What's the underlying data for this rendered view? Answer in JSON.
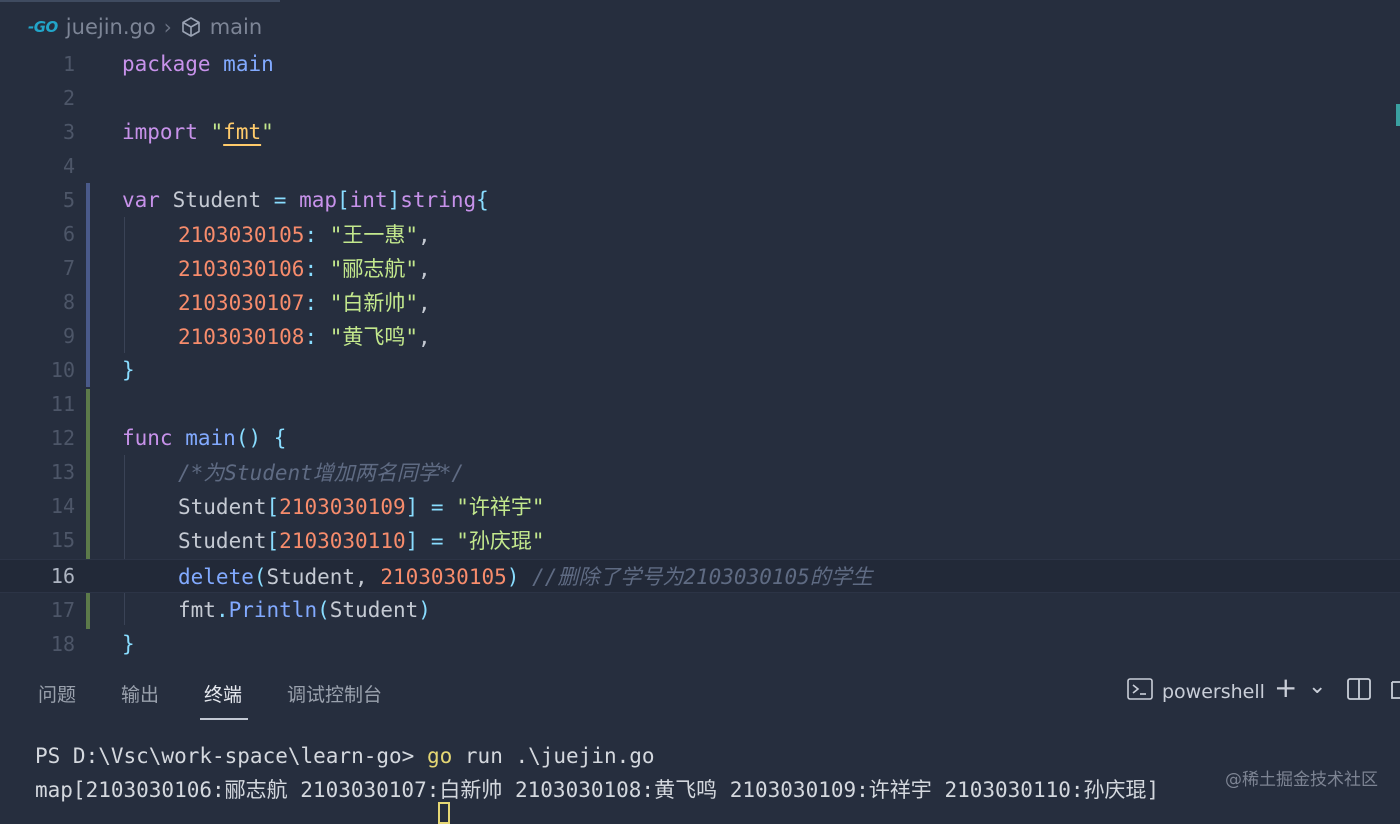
{
  "breadcrumb": {
    "go_badge": "-GO",
    "file": "juejin.go",
    "separator": "›",
    "symbol": "main"
  },
  "editor": {
    "line_numbers": [
      "1",
      "2",
      "3",
      "4",
      "5",
      "6",
      "7",
      "8",
      "9",
      "10",
      "11",
      "12",
      "13",
      "14",
      "15",
      "16",
      "17",
      "18"
    ],
    "active_line": 16,
    "lines": {
      "l1": {
        "kw": "package",
        "name": "main"
      },
      "l3": {
        "kw": "import",
        "q1": "\"",
        "pkg": "fmt",
        "q2": "\""
      },
      "l5": {
        "kw": "var",
        "rest1": "Student ",
        "eq": "=",
        "map": "map",
        "br1": "[",
        "int": "int",
        "br2": "]",
        "str": "string",
        "brace": "{"
      },
      "l6": {
        "num": "2103030105",
        "colon": ":",
        "str": "\"王一惠\"",
        "comma": ","
      },
      "l7": {
        "num": "2103030106",
        "colon": ":",
        "str": "\"郦志航\"",
        "comma": ","
      },
      "l8": {
        "num": "2103030107",
        "colon": ":",
        "str": "\"白新帅\"",
        "comma": ","
      },
      "l9": {
        "num": "2103030108",
        "colon": ":",
        "str": "\"黄飞鸣\"",
        "comma": ","
      },
      "l10": {
        "brace": "}"
      },
      "l12": {
        "kw": "func",
        "name": "main",
        "paren": "()",
        "brace": "{"
      },
      "l13": {
        "comment": "/*为Student增加两名同学*/"
      },
      "l14": {
        "var": "Student",
        "br1": "[",
        "num": "2103030109",
        "br2": "]",
        "eq": "=",
        "str": "\"许祥宇\""
      },
      "l15": {
        "var": "Student",
        "br1": "[",
        "num": "2103030110",
        "br2": "]",
        "eq": "=",
        "str": "\"孙庆琨\""
      },
      "l16": {
        "fn": "delete",
        "p1": "(",
        "arg": "Student, ",
        "num": "2103030105",
        "p2": ")",
        "comment": "//删除了学号为2103030105的学生"
      },
      "l17": {
        "pkg": "fmt",
        "dot": ".",
        "fn": "Println",
        "p1": "(",
        "arg": "Student",
        "p2": ")"
      },
      "l18": {
        "brace": "}"
      }
    }
  },
  "panel": {
    "tabs": [
      "问题",
      "输出",
      "终端",
      "调试控制台"
    ],
    "active_tab": "终端",
    "shell_name": "powershell",
    "add_label": "+",
    "dropdown_label": "⌄"
  },
  "terminal": {
    "prompt": "PS D:\\Vsc\\work-space\\learn-go>",
    "command": "go",
    "args": "run .\\juejin.go",
    "output": "map[2103030106:郦志航 2103030107:白新帅 2103030108:黄飞鸣 2103030109:许祥宇 2103030110:孙庆琨]"
  },
  "watermark": "@稀土掘金技术社区",
  "colors": {
    "background": "#262e3e",
    "keyword": "#c792ea",
    "function": "#82aaff",
    "string": "#c3e88d",
    "number": "#f78c6c",
    "comment": "#5f6b83",
    "package": "#ffcb6b"
  }
}
